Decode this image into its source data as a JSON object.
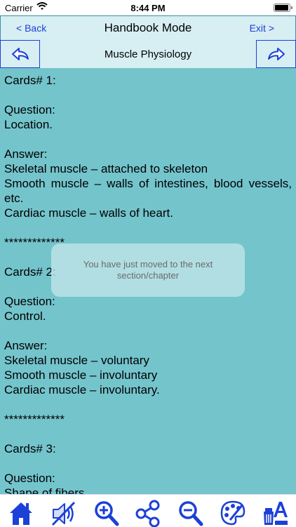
{
  "status_bar": {
    "carrier": "Carrier",
    "time": "8:44 PM"
  },
  "nav_bar": {
    "back_label": "< Back",
    "title": "Handbook Mode",
    "exit_label": "Exit >"
  },
  "chapter_bar": {
    "title": "Muscle Physiology"
  },
  "content": {
    "card1": {
      "header": "Cards# 1:",
      "question_label": "Question:",
      "question": "Location.",
      "answer_label": "Answer:",
      "answer_lines": [
        "Skeletal muscle – attached to skeleton",
        "Smooth muscle – walls of intestines, blood vessels, etc.",
        "Cardiac muscle – walls of heart."
      ]
    },
    "separator1": "*************",
    "card2": {
      "header": "Cards# 2:",
      "question_label": "Question:",
      "question": "Control.",
      "answer_label": "Answer:",
      "answer_lines": [
        "Skeletal muscle – voluntary",
        "Smooth muscle – involuntary",
        "Cardiac muscle – involuntary."
      ]
    },
    "separator2": "*************",
    "card3": {
      "header": "Cards# 3:",
      "question_label": "Question:",
      "question": "Shape of fibers"
    }
  },
  "toast": {
    "line1": "You have just moved to the next",
    "line2": "section/chapter"
  },
  "toolbar": {
    "items": [
      "home-icon",
      "speaker-muted-icon",
      "zoom-in-icon",
      "share-icon",
      "zoom-out-icon",
      "palette-icon",
      "font-style-icon"
    ]
  },
  "colors": {
    "background": "#74c4cc",
    "accent": "#1c40d8",
    "bar": "#d7eef3"
  }
}
